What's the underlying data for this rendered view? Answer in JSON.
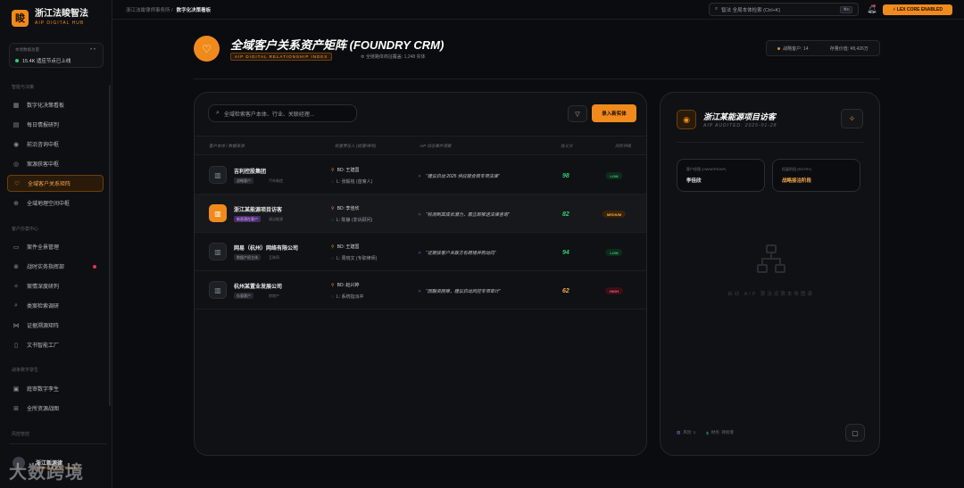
{
  "brand": {
    "logo_char": "睃",
    "name": "浙江法睃智法",
    "sub": "AIP DIGITAL HUB"
  },
  "status": {
    "label": "本地数据总量",
    "dots": "• •",
    "value": "15.4K 适应节点已上线"
  },
  "sidebar": {
    "group1": "智能与决策",
    "group1_items": [
      {
        "label": "数字化决策看板",
        "icon": "grid-icon"
      },
      {
        "label": "每日情报研判",
        "icon": "doc-icon"
      },
      {
        "label": "前沿咨询中枢",
        "icon": "eye-icon"
      },
      {
        "label": "案源获客中枢",
        "icon": "target-icon"
      },
      {
        "label": "全域客户关系矩阵",
        "icon": "heart-icon",
        "active": true
      },
      {
        "label": "全域地理空间中枢",
        "icon": "globe-icon"
      }
    ],
    "group2": "客户办案中心",
    "group2_items": [
      {
        "label": "案件全景管理",
        "icon": "folder-icon"
      },
      {
        "label": "战时实务指挥部",
        "icon": "crosshair-icon",
        "badge": true
      },
      {
        "label": "案情深度研判",
        "icon": "sparkle-icon"
      },
      {
        "label": "类案检索调研",
        "icon": "search-icon"
      },
      {
        "label": "证据溯源矩阵",
        "icon": "network-icon"
      },
      {
        "label": "文书智能工厂",
        "icon": "file-icon"
      }
    ],
    "group3": "战争数字孪生",
    "group3_items": [
      {
        "label": "庭审数字孪生",
        "icon": "display-icon"
      },
      {
        "label": "全所资源战图",
        "icon": "map-icon"
      }
    ],
    "group4": "风控管控",
    "user_name": "浙江新源律",
    "user_role": "SENIOR PARTNER",
    "watermark": "大数跨境"
  },
  "topbar": {
    "crumb_parent": "浙江法睃律师事务所 /",
    "crumb_current": "数字化决策看板",
    "search": "智法 全局本体检索 (Ctrl+K)",
    "search_kbd": "⌘K",
    "core_badge": "⚡ LEX CORE ENABLED"
  },
  "header": {
    "title": "全域客户关系资产矩阵 (FOUNDRY CRM)",
    "tag": "AIP DIGITAL RELATIONSHIP INDEX",
    "meta": "⚙ 全链路体商征覆盖: 1,248 实体",
    "stat1": "战略客户: 14",
    "stat2": "存量价值: ¥8,426万"
  },
  "main": {
    "search_placeholder": "全域检索客户本体、行业、关联经理...",
    "import_label": "录入新实体",
    "columns": [
      "客户本体 / 数据来源",
      "权重责任人 (经理/律师)",
      "AIP 动态事件洞察",
      "信义分",
      "风险评级"
    ],
    "rows": [
      {
        "name": "吉利控股集团",
        "chip": "战略客户",
        "chip2": "汽车制造",
        "bd": "BD: 王建国",
        "lawyer": "L: 张毅铭 (首席人)",
        "insight": "“建议启动 2025 供应链合规专项法律”",
        "score": "98",
        "risk": "LOW",
        "risk_class": "low",
        "score_color": "#2ecc71"
      },
      {
        "name": "浙江某能源项目访客",
        "chip": "新晋潜在客户",
        "chip2": "清洁能源",
        "bd": "BD: 李佳欣",
        "lawyer": "L: 陈静 (非诉顾问)",
        "insight": "“检测到其成长潜力，需立即推送法律咨询”",
        "score": "82",
        "risk": "MEDIUM",
        "risk_class": "medium",
        "score_color": "#2ecc71",
        "selected": true
      },
      {
        "name": "网易（杭州）网络有限公司",
        "chip": "数据产权主体",
        "chip2": "互联网",
        "bd": "BD: 王建国",
        "lawyer": "L: 周晓文 (专职律师)",
        "insight": "“近期该客户关联方有跨境并购动向”",
        "score": "94",
        "risk": "LOW",
        "risk_class": "low",
        "score_color": "#2ecc71"
      },
      {
        "name": "杭州某置业发展公司",
        "chip": "存量客户",
        "chip2": "房地产",
        "bd": "BD: 赵兴婷",
        "lawyer": "L: 系统指派中",
        "insight": "“因融资困难，建议启动风控专项审计”",
        "score": "62",
        "risk": "HIGH",
        "risk_class": "high",
        "score_color": "#f5a84a"
      }
    ]
  },
  "side": {
    "title": "浙江某能源项目访客",
    "sub": "AIP AUDITED: 2025-01-28",
    "kv1_k": "客户经理 (OWNERSHIP)",
    "kv1_v": "李佳欣",
    "kv2_k": "拓展阶段 (ENTRY)",
    "kv2_v": "战略接洽阶段",
    "placeholder": "启动 AIP 算法运算本体图谱",
    "foot1": "风险: 1",
    "foot2": "财务: 持续增"
  }
}
